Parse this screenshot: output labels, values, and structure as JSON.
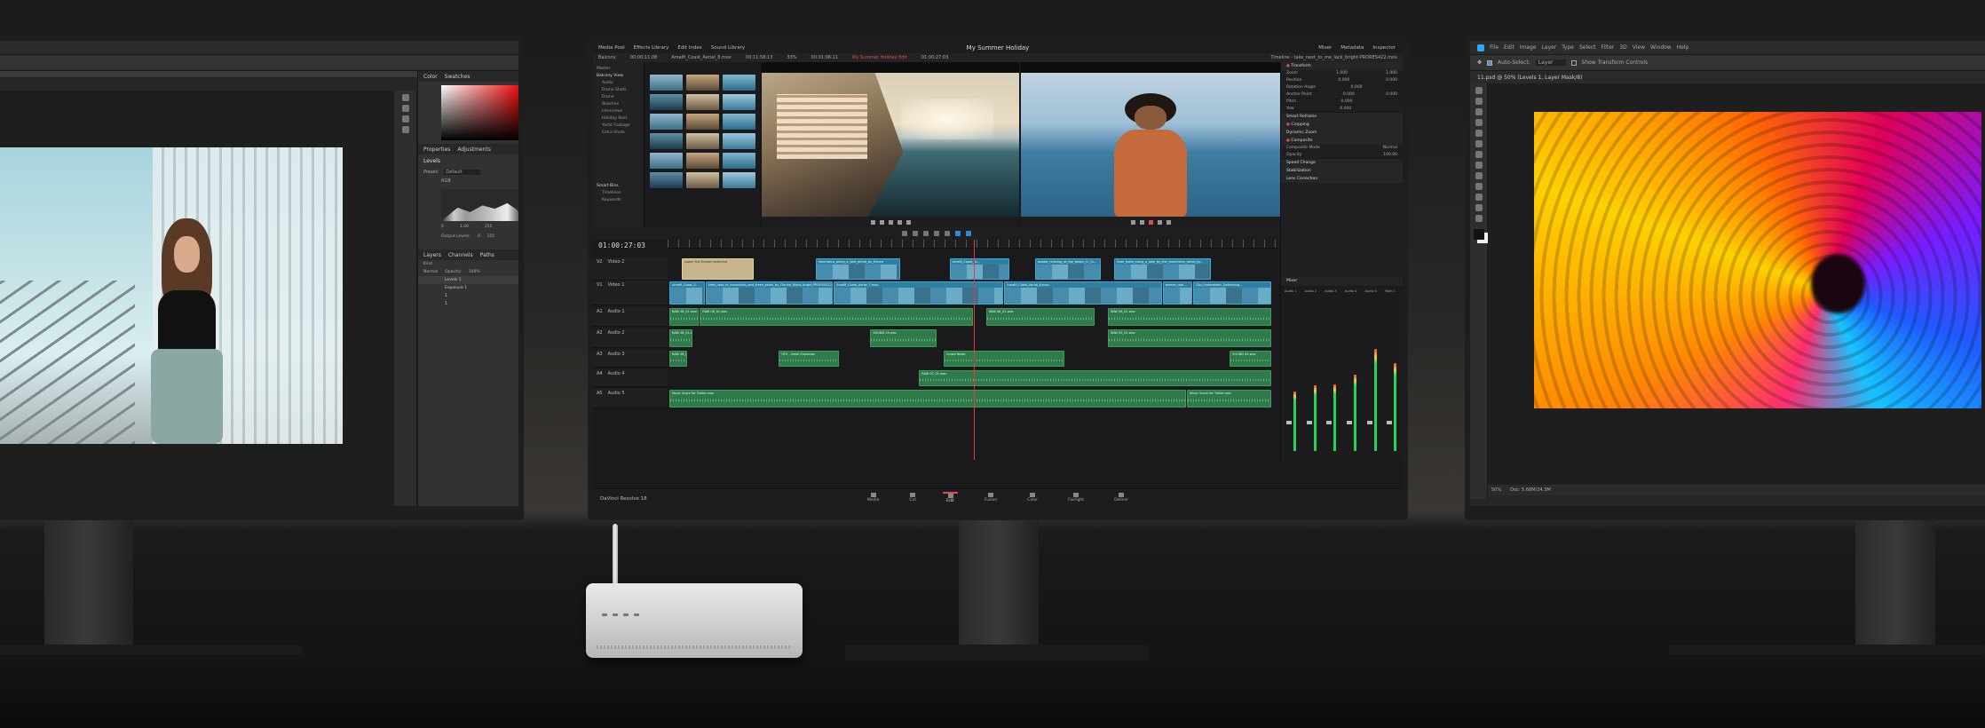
{
  "colors": {
    "resolve_accent": "#e24b4b",
    "video_clip": "#2d7fa3",
    "audio_clip": "#2f7a4a",
    "meter_green": "#1fd65a"
  },
  "left_app": {
    "panel_tabs_top": [
      "Color",
      "Swatches"
    ],
    "panel_tabs_mid": [
      "Properties",
      "Adjustments"
    ],
    "properties_title": "Levels",
    "preset_label": "Preset:",
    "preset_value": "Default",
    "channel_value": "RGB",
    "input_values": [
      "0",
      "1.00",
      "255"
    ],
    "output_label": "Output Levels:",
    "output_values": [
      "0",
      "255"
    ],
    "layers_tabs": [
      "Layers",
      "Channels",
      "Paths"
    ],
    "layers_kind": "Kind",
    "blend_mode": "Normal",
    "opacity_label": "Opacity:",
    "opacity_value": "100%",
    "layers": [
      "Levels 1",
      "Exposure 1",
      "1",
      "1"
    ]
  },
  "right_app": {
    "menu": [
      "File",
      "Edit",
      "Image",
      "Layer",
      "Type",
      "Select",
      "Filter",
      "3D",
      "View",
      "Window",
      "Help"
    ],
    "auto_select_label": "Auto-Select:",
    "auto_select_value": "Layer",
    "transform_label": "Show Transform Controls",
    "doc_tab": "11.psd @ 50% (Levels 1, Layer Mask/8)",
    "status_zoom": "50%",
    "status_doc": "Doc: 5.68M/24.3M"
  },
  "resolve": {
    "top_tabs": [
      "Media Pool",
      "Effects Library",
      "Edit Index",
      "Sound Library"
    ],
    "project_title": "My Summer Holiday",
    "top_right_tabs": [
      "Mixer",
      "Metadata",
      "Inspector"
    ],
    "bin_name": "Balcony",
    "timecode_src": "00:00:11:08",
    "src_clip_name": "Amalfi_Coast_Aerial_8.mov",
    "timecode_prog_in": "00:11:58:13",
    "zoom": "33%",
    "timecode_prog": "00:01:06:11",
    "timeline_name": "My Summer Holiday Edit",
    "timecode_prog_out": "01:00:27:03",
    "inspector_title": "Timeline - take_next_to_me_lack_bright-PRORES422.mov",
    "bin_list": [
      "Master",
      "Balcony View",
      "Audio",
      "Drone Shots",
      "Drone",
      "Beaches",
      "Interviews",
      "Holiday Reel",
      "Yacht Footage",
      "Extra Shots"
    ],
    "smart_bins_label": "Smart Bins",
    "smart_bins": [
      "Timelines",
      "Keywords"
    ],
    "inspector_sections": [
      {
        "title": "Transform",
        "active": true
      },
      {
        "title": "Smart Reframe",
        "active": false
      },
      {
        "title": "Cropping",
        "active": true
      },
      {
        "title": "Dynamic Zoom",
        "active": false
      },
      {
        "title": "Composite",
        "active": true
      },
      {
        "title": "Speed Change",
        "active": false
      },
      {
        "title": "Stabilization",
        "active": false
      },
      {
        "title": "Lens Correction",
        "active": false
      }
    ],
    "transform_rows": [
      {
        "label": "Zoom",
        "x": "1.000",
        "y": "1.000"
      },
      {
        "label": "Position",
        "x": "0.000",
        "y": "0.000"
      },
      {
        "label": "Rotation Angle",
        "x": "0.000",
        "y": ""
      },
      {
        "label": "Anchor Point",
        "x": "0.000",
        "y": "0.000"
      },
      {
        "label": "Pitch",
        "x": "0.000",
        "y": ""
      },
      {
        "label": "Yaw",
        "x": "0.000",
        "y": ""
      }
    ],
    "composite_mode_label": "Composite Mode",
    "composite_mode": "Normal",
    "opacity_label": "Opacity",
    "opacity_value": "100.00",
    "timeline_timecode": "01:00:27:03",
    "tracks": [
      {
        "id": "V2",
        "name": "Video 2"
      },
      {
        "id": "V1",
        "name": "Video 1"
      },
      {
        "id": "A1",
        "name": "Audio 1"
      },
      {
        "id": "A2",
        "name": "Audio 2"
      },
      {
        "id": "A3",
        "name": "Audio 3"
      },
      {
        "id": "A4",
        "name": "Audio 4"
      },
      {
        "id": "A5",
        "name": "Audio 5"
      }
    ],
    "clips": [
      {
        "track": 0,
        "type": "beige",
        "start": 0.02,
        "end": 0.14,
        "label": "Lower 3rd Simple Underline"
      },
      {
        "track": 0,
        "type": "video",
        "start": 0.24,
        "end": 0.38,
        "label": "mountains_along_a_lake_aerial_by_france"
      },
      {
        "track": 0,
        "type": "video",
        "start": 0.46,
        "end": 0.56,
        "label": "Amalfi_Coast_Sc..."
      },
      {
        "track": 0,
        "type": "video",
        "start": 0.6,
        "end": 0.71,
        "label": "people_relaxing_at_the_beach_in_Gr..."
      },
      {
        "track": 0,
        "type": "video",
        "start": 0.73,
        "end": 0.89,
        "label": "Gran_hotel_along_a_lake_by_the_mountains_aerial_by..."
      },
      {
        "track": 1,
        "type": "video",
        "start": 0.0,
        "end": 0.06,
        "label": "Amalfi_Coast_S..."
      },
      {
        "track": 1,
        "type": "video",
        "start": 0.06,
        "end": 0.27,
        "label": "take_next_to_mountains_and_trees_aerial_by_Florine_Blank_bright-PRORES422"
      },
      {
        "track": 1,
        "type": "video",
        "start": 0.27,
        "end": 0.55,
        "label": "Amalfi_Coast_Aerial_7.mov"
      },
      {
        "track": 1,
        "type": "video",
        "start": 0.55,
        "end": 0.81,
        "label": "Amalfi_Coast_Aerial_8.mov"
      },
      {
        "track": 1,
        "type": "video",
        "start": 0.81,
        "end": 0.86,
        "label": "woman_wal..."
      },
      {
        "track": 1,
        "type": "video",
        "start": 0.86,
        "end": 0.99,
        "label": "Clip_Underwater_Swimming..."
      },
      {
        "track": 2,
        "type": "audio",
        "start": 0.0,
        "end": 0.05,
        "label": "RAW 06_01.wav"
      },
      {
        "track": 2,
        "type": "audio",
        "start": 0.05,
        "end": 0.5,
        "label": "RAW 06_01.wav"
      },
      {
        "track": 2,
        "type": "audio",
        "start": 0.52,
        "end": 0.7,
        "label": "RAW 06_01.wav"
      },
      {
        "track": 2,
        "type": "audio",
        "start": 0.72,
        "end": 0.99,
        "label": "RAW 06_01.wav"
      },
      {
        "track": 3,
        "type": "audio",
        "start": 0.0,
        "end": 0.04,
        "label": "RAW 06_01.wav"
      },
      {
        "track": 3,
        "type": "audio",
        "start": 0.33,
        "end": 0.44,
        "label": "SOUND 05.wav"
      },
      {
        "track": 3,
        "type": "audio",
        "start": 0.72,
        "end": 0.99,
        "label": "RAW 05_01.wav"
      },
      {
        "track": 4,
        "type": "audio",
        "start": 0.0,
        "end": 0.03,
        "label": "RAW 06_01.wav"
      },
      {
        "track": 4,
        "type": "audio",
        "start": 0.18,
        "end": 0.28,
        "label": "SFX - Small Explosion"
      },
      {
        "track": 4,
        "type": "audio",
        "start": 0.45,
        "end": 0.65,
        "label": "Crowd Noise"
      },
      {
        "track": 4,
        "type": "audio",
        "start": 0.92,
        "end": 0.99,
        "label": "SOUND 05.wav"
      },
      {
        "track": 5,
        "type": "audio",
        "start": 0.41,
        "end": 0.99,
        "label": "RAW 07_01.wav"
      },
      {
        "track": 6,
        "type": "audio",
        "start": 0.0,
        "end": 0.85,
        "label": "Music Score for Trailer.mov"
      },
      {
        "track": 6,
        "type": "audio",
        "start": 0.85,
        "end": 0.99,
        "label": "Music Score for Trailer.mov"
      }
    ],
    "playhead_fraction": 0.5,
    "mixer_label": "Mixer",
    "mixer_channels": [
      "Audio 1",
      "Audio 2",
      "Audio 3",
      "Audio 4",
      "Audio 5",
      "Main 1"
    ],
    "meter_levels": [
      0.42,
      0.46,
      0.47,
      0.54,
      0.72,
      0.62
    ],
    "pages": [
      "Media",
      "Cut",
      "Edit",
      "Fusion",
      "Color",
      "Fairlight",
      "Deliver"
    ],
    "active_page": "Edit",
    "brand": "DaVinci Resolve 18"
  }
}
